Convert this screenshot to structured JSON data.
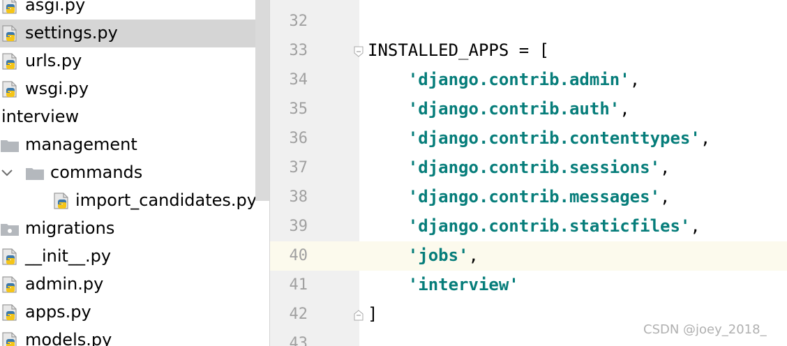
{
  "project_tree": {
    "items": [
      {
        "label": "asgi.py",
        "kind": "python-file"
      },
      {
        "label": "settings.py",
        "kind": "python-file",
        "selected": true
      },
      {
        "label": "urls.py",
        "kind": "python-file"
      },
      {
        "label": "wsgi.py",
        "kind": "python-file"
      },
      {
        "label": "interview",
        "kind": "text"
      },
      {
        "label": "management",
        "kind": "folder"
      },
      {
        "label": "commands",
        "kind": "folder",
        "expanded": true
      },
      {
        "label": "import_candidates.py",
        "kind": "python-file"
      },
      {
        "label": "migrations",
        "kind": "package"
      },
      {
        "label": "__init__.py",
        "kind": "python-file"
      },
      {
        "label": "admin.py",
        "kind": "python-file"
      },
      {
        "label": "apps.py",
        "kind": "python-file"
      },
      {
        "label": "models.py",
        "kind": "python-file"
      }
    ]
  },
  "editor": {
    "current_line": "40",
    "lines": [
      {
        "num": "32",
        "prefix": "",
        "string": "",
        "suffix": ""
      },
      {
        "num": "33",
        "prefix": "INSTALLED_APPS = [",
        "string": "",
        "suffix": ""
      },
      {
        "num": "34",
        "prefix": "    ",
        "string": "'django.contrib.admin'",
        "suffix": ","
      },
      {
        "num": "35",
        "prefix": "    ",
        "string": "'django.contrib.auth'",
        "suffix": ","
      },
      {
        "num": "36",
        "prefix": "    ",
        "string": "'django.contrib.contenttypes'",
        "suffix": ","
      },
      {
        "num": "37",
        "prefix": "    ",
        "string": "'django.contrib.sessions'",
        "suffix": ","
      },
      {
        "num": "38",
        "prefix": "    ",
        "string": "'django.contrib.messages'",
        "suffix": ","
      },
      {
        "num": "39",
        "prefix": "    ",
        "string": "'django.contrib.staticfiles'",
        "suffix": ","
      },
      {
        "num": "40",
        "prefix": "    ",
        "string": "'jobs'",
        "suffix": ","
      },
      {
        "num": "41",
        "prefix": "    ",
        "string": "'interview'",
        "suffix": ""
      },
      {
        "num": "42",
        "prefix": "]",
        "string": "",
        "suffix": ""
      },
      {
        "num": "43",
        "prefix": "",
        "string": "",
        "suffix": ""
      }
    ]
  },
  "watermark": "CSDN @joey_2018_",
  "colors": {
    "string": "#067d7a",
    "gutter_bg": "#f0f0f0",
    "current_line_bg": "#fcfaed",
    "selected_row_bg": "#d5d5d5",
    "line_number": "#a0a0a0"
  }
}
